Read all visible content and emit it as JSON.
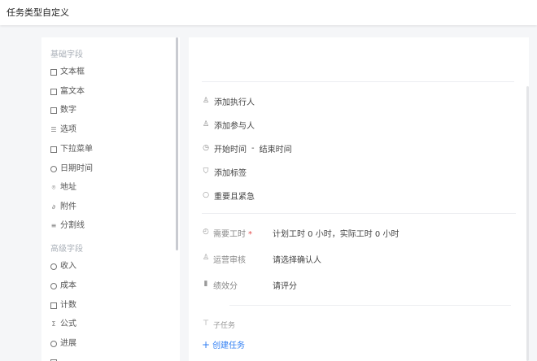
{
  "header": {
    "title": "任务类型自定义"
  },
  "sidebar": {
    "basic_section": "基础字段",
    "basic_items": [
      {
        "label": "文本框",
        "icon": "textbox-icon"
      },
      {
        "label": "富文本",
        "icon": "richtext-icon"
      },
      {
        "label": "数字",
        "icon": "number-icon"
      },
      {
        "label": "选项",
        "icon": "list-icon"
      },
      {
        "label": "下拉菜单",
        "icon": "dropdown-icon"
      },
      {
        "label": "日期时间",
        "icon": "clock-icon"
      },
      {
        "label": "地址",
        "icon": "location-icon"
      },
      {
        "label": "附件",
        "icon": "paperclip-icon"
      },
      {
        "label": "分割线",
        "icon": "divider-icon"
      }
    ],
    "advanced_section": "高级字段",
    "advanced_items": [
      {
        "label": "收入",
        "icon": "dollar-icon"
      },
      {
        "label": "成本",
        "icon": "cost-icon"
      },
      {
        "label": "计数",
        "icon": "counter-icon"
      },
      {
        "label": "公式",
        "icon": "sigma-icon"
      },
      {
        "label": "进展",
        "icon": "progress-icon"
      }
    ]
  },
  "panel": {
    "add_assignee": "添加执行人",
    "add_participant": "添加参与人",
    "start_time": "开始时间",
    "time_sep": "-",
    "end_time": "结束时间",
    "add_tag": "添加标签",
    "priority": "重要且紧急",
    "work_hours_label": "需要工时",
    "work_hours_required": "*",
    "work_hours_value": "计划工时 0 小时，实际工时 0 小时",
    "review_label": "运营审核",
    "review_value": "请选择确认人",
    "score_label": "绩效分",
    "score_value": "请评分",
    "subtask_label": "子任务",
    "create_task": "创建任务",
    "create_task_plus": "+"
  },
  "colors": {
    "accent": "#2f7ef3",
    "required": "#e34d4d"
  }
}
